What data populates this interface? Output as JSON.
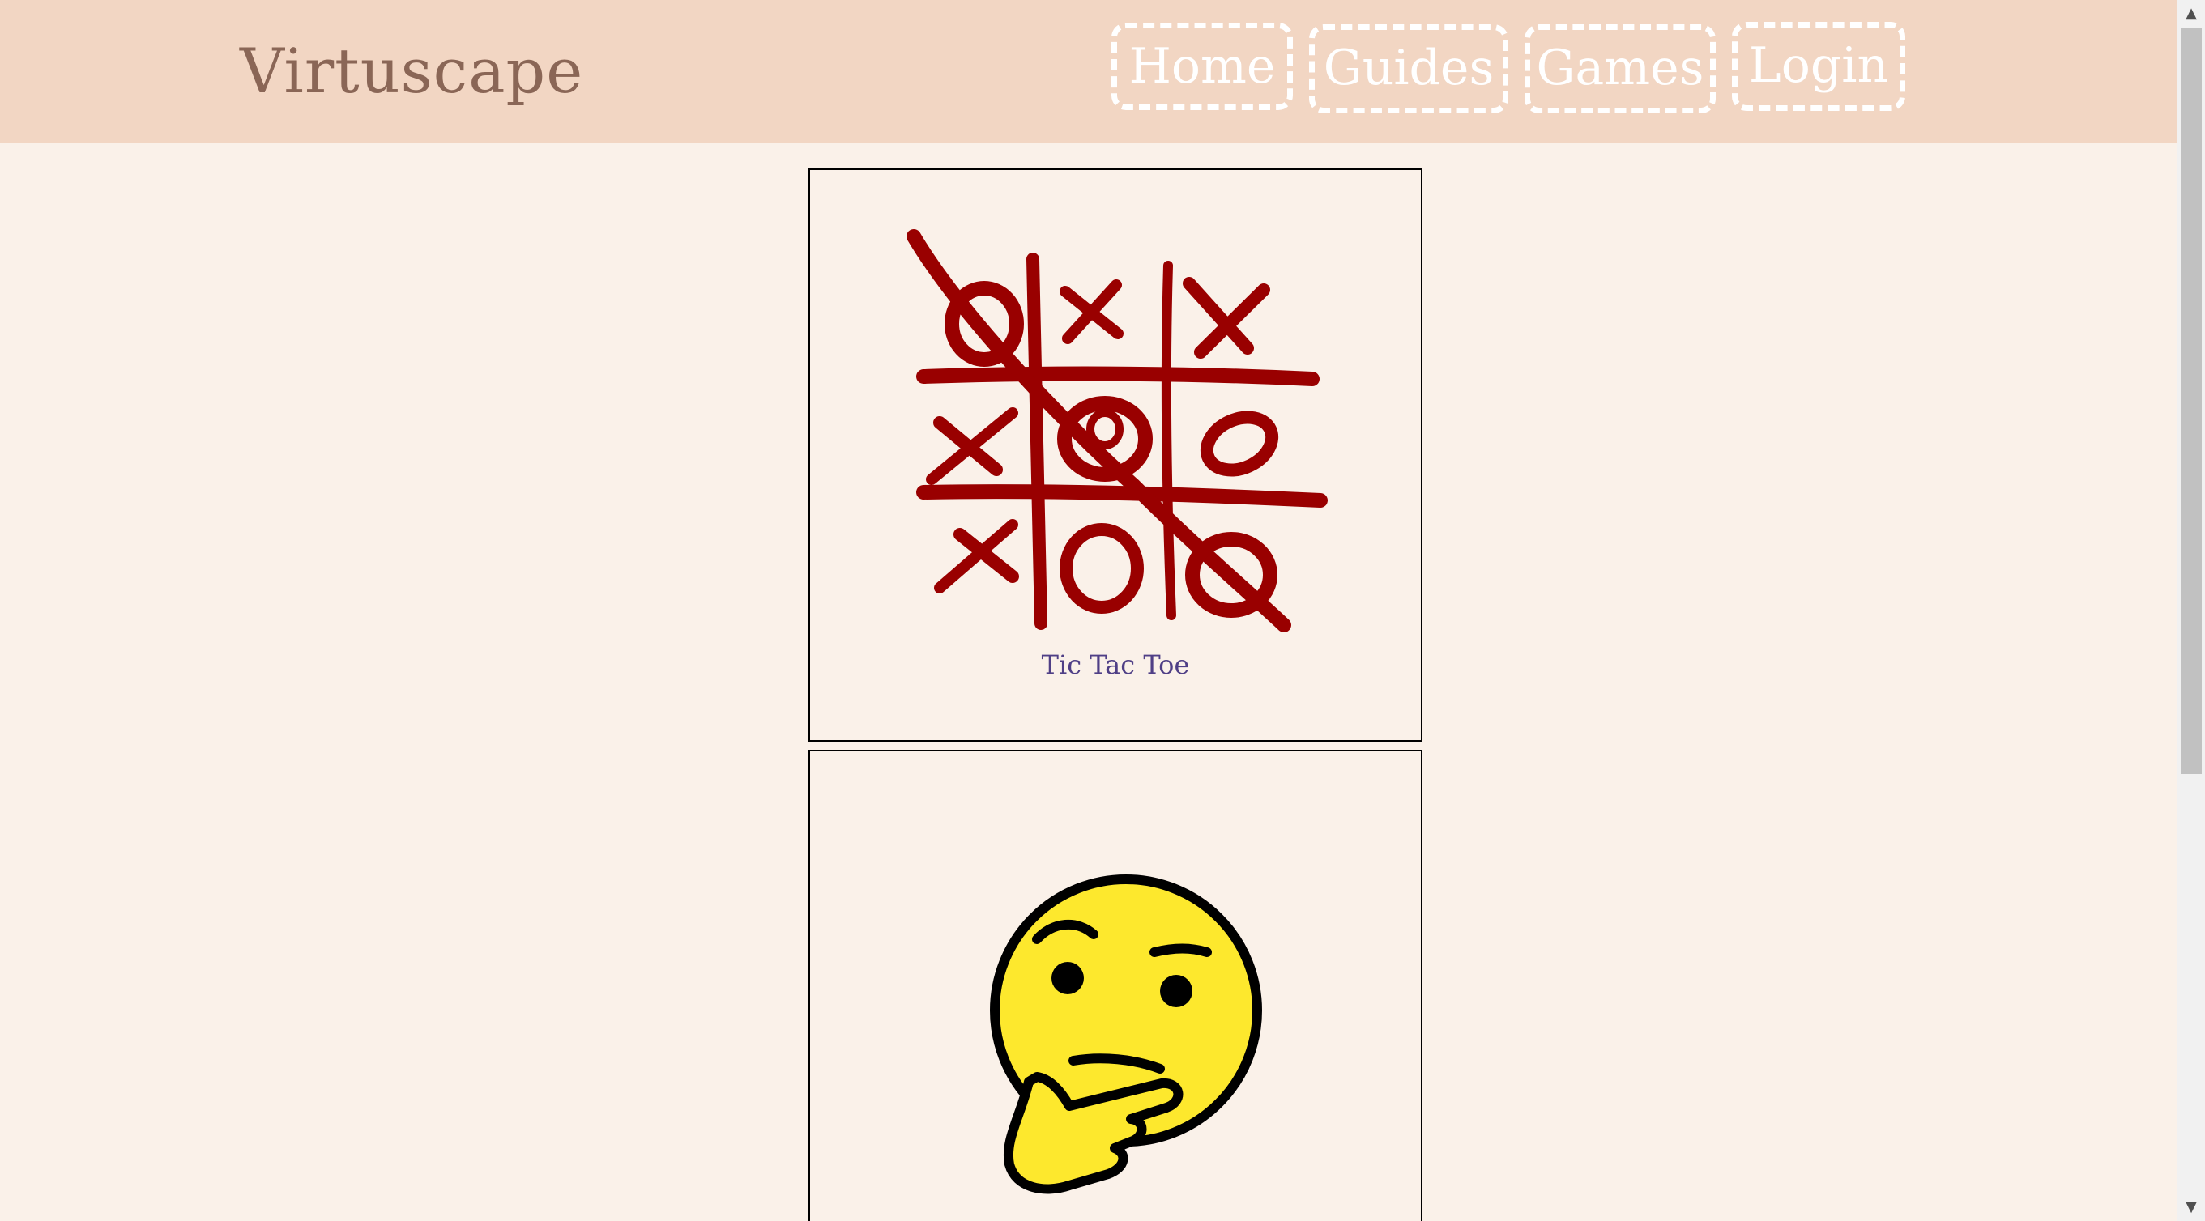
{
  "header": {
    "brand": "Virtuscape",
    "background_color": "#f2d6c3",
    "nav": [
      {
        "label": "Home"
      },
      {
        "label": "Guides"
      },
      {
        "label": "Games"
      },
      {
        "label": "Login"
      }
    ]
  },
  "cards": [
    {
      "label": "Tic Tac Toe",
      "icon": "tic-tac-toe-icon",
      "ink_color": "#990000"
    },
    {
      "label": "",
      "icon": "thinking-face-icon",
      "face_color": "#fde82d"
    }
  ],
  "page": {
    "background_color": "#faf1e9",
    "label_color": "#4f3f86"
  }
}
